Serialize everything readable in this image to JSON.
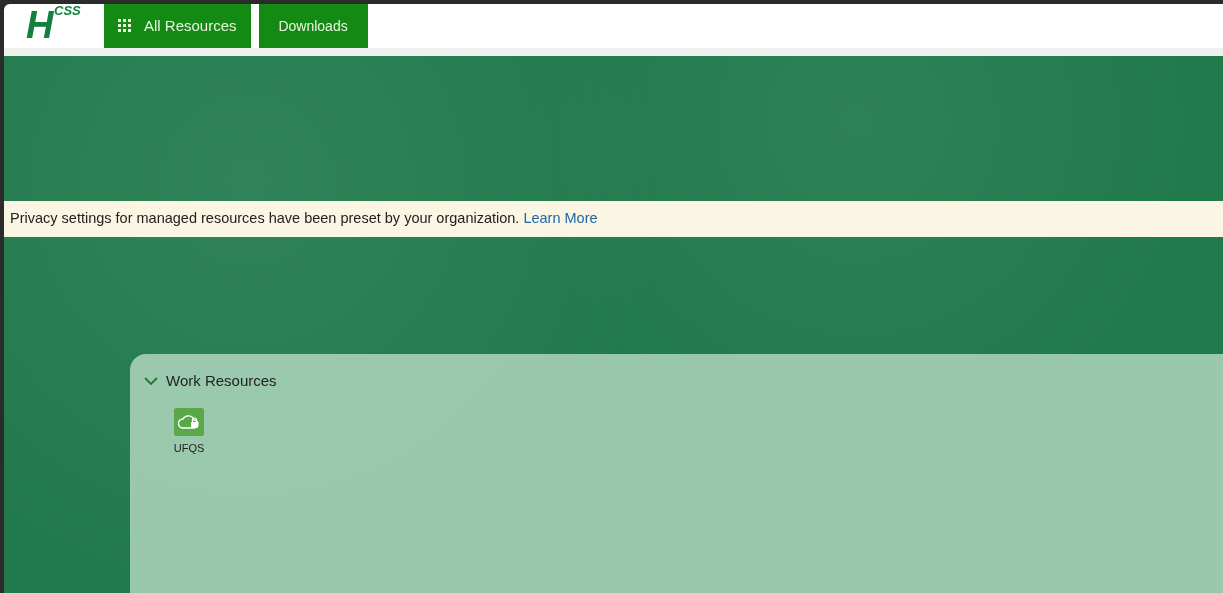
{
  "logo": {
    "main": "H",
    "sub": "CSS"
  },
  "nav": [
    {
      "label": "All Resources",
      "kind": "grid"
    },
    {
      "label": "Downloads",
      "kind": "plain"
    }
  ],
  "notice": {
    "text": "Privacy settings for managed resources have been preset by your organization.",
    "link": "Learn More"
  },
  "section": {
    "title": "Work Resources",
    "expanded": true,
    "items": [
      {
        "label": "UFQS"
      }
    ]
  }
}
